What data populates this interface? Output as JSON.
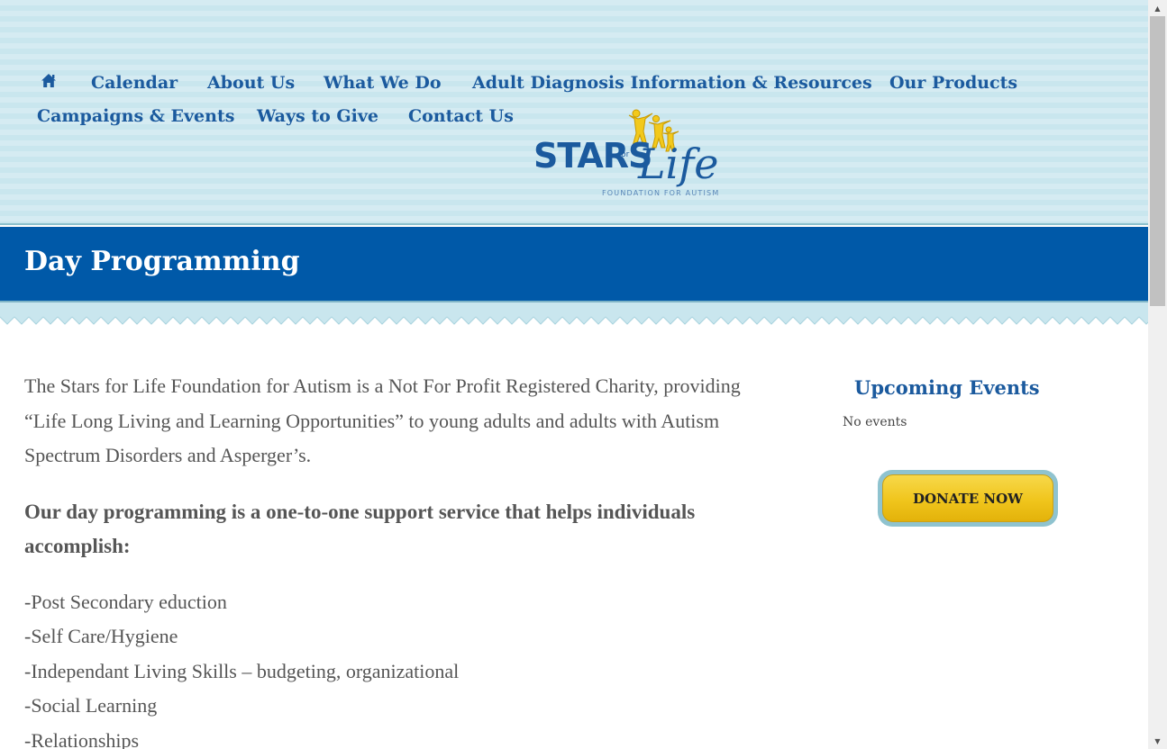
{
  "nav": {
    "home_icon": "home-icon",
    "items": [
      {
        "label": "Calendar"
      },
      {
        "label": "About Us"
      },
      {
        "label": "What We Do"
      },
      {
        "label": "Adult Diagnosis Information & Resources"
      },
      {
        "label": "Our Products"
      },
      {
        "label": "Campaigns & Events"
      },
      {
        "label": "Ways to Give"
      },
      {
        "label": "Contact Us"
      }
    ]
  },
  "logo": {
    "stars": "STARS",
    "for": "for",
    "life": "Life",
    "tagline": "FOUNDATION    FOR AUTISM"
  },
  "page": {
    "title": "Day Programming"
  },
  "content": {
    "intro": "The Stars for Life Foundation for Autism is a Not For Profit Registered Charity, providing “Life Long Living and Learning Opportunities” to young adults and adults with Autism Spectrum Disorders and Asperger’s.",
    "lead": "Our day programming is a one-to-one support service that helps individuals accomplish:",
    "list": [
      "-Post Secondary eduction",
      "-Self Care/Hygiene",
      "-Independant Living Skills – budgeting, organizational",
      "-Social Learning",
      "-Relationships"
    ]
  },
  "sidebar": {
    "events_title": "Upcoming Events",
    "events_empty": "No events",
    "donate_label": "DONATE NOW"
  },
  "colors": {
    "header_bg": "#c9e6ee",
    "nav_text": "#1b5a9e",
    "titlebar_bg": "#0059a8",
    "donate_yellow": "#f0c51c",
    "donate_ring": "#8fc3cf"
  }
}
